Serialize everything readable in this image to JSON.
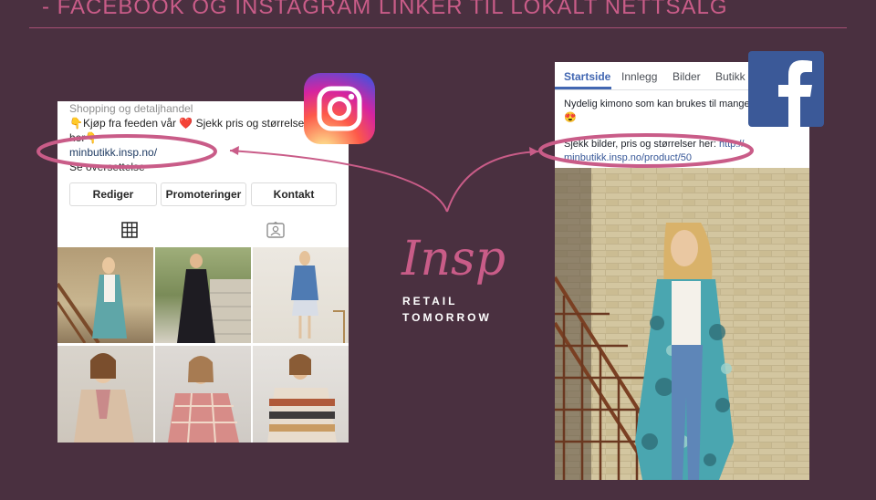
{
  "slide": {
    "title": "- FACEBOOK OG INSTAGRAM LINKER TIL LOKALT NETTSALG"
  },
  "instagram": {
    "category": "Shopping og detaljhandel",
    "bio_line1": "👇Kjøp fra feeden vår ❤️ Sjekk pris og størrelser",
    "bio_line2": "her👇",
    "link": "minbutikk.insp.no/",
    "see_translation": "Se oversettelse",
    "buttons": [
      "Rediger",
      "Promoteringer",
      "Kontakt"
    ]
  },
  "facebook": {
    "tabs": [
      "Startside",
      "Innlegg",
      "Bilder",
      "Butikk"
    ],
    "active_tab": "Startside",
    "post_line1": "Nydelig kimono som kan brukes til mange",
    "post_emoji": "😍",
    "post_line2_text": "Sjekk bilder, pris og størrelser her: ",
    "post_line2_link": "http://",
    "post_link": "minbutikk.insp.no/product/50"
  },
  "brand": {
    "script": "Insp",
    "line1": "RETAIL",
    "line2": "TOMORROW"
  },
  "colors": {
    "background": "#4a3040",
    "accent": "#c95c88",
    "facebook_blue": "#3b5998",
    "link_blue": "#385898"
  },
  "icons": [
    "instagram-logo",
    "facebook-logo",
    "grid-icon",
    "tagged-icon"
  ]
}
